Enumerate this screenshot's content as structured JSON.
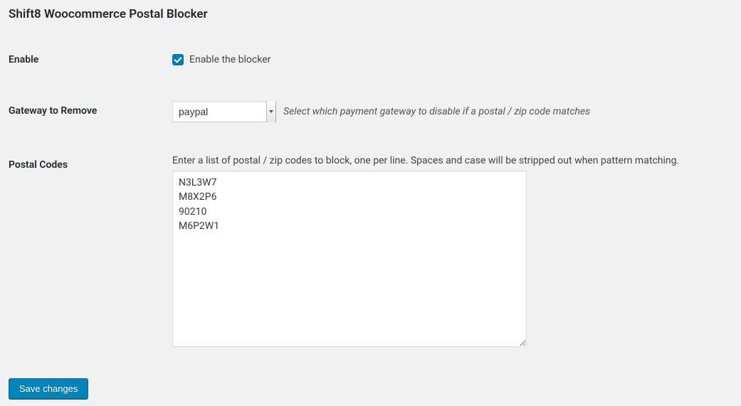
{
  "page": {
    "title": "Shift8 Woocommerce Postal Blocker"
  },
  "fields": {
    "enable": {
      "label": "Enable",
      "checkbox_label": "Enable the blocker",
      "checked": true
    },
    "gateway": {
      "label": "Gateway to Remove",
      "value": "paypal",
      "hint": "Select which payment gateway to disable if a postal / zip code matches"
    },
    "postal_codes": {
      "label": "Postal Codes",
      "description": "Enter a list of postal / zip codes to block, one per line. Spaces and case will be stripped out when pattern matching.",
      "value": "N3L3W7\nM8X2P6\n90210\nM6P2W1"
    }
  },
  "submit": {
    "label": "Save changes"
  }
}
